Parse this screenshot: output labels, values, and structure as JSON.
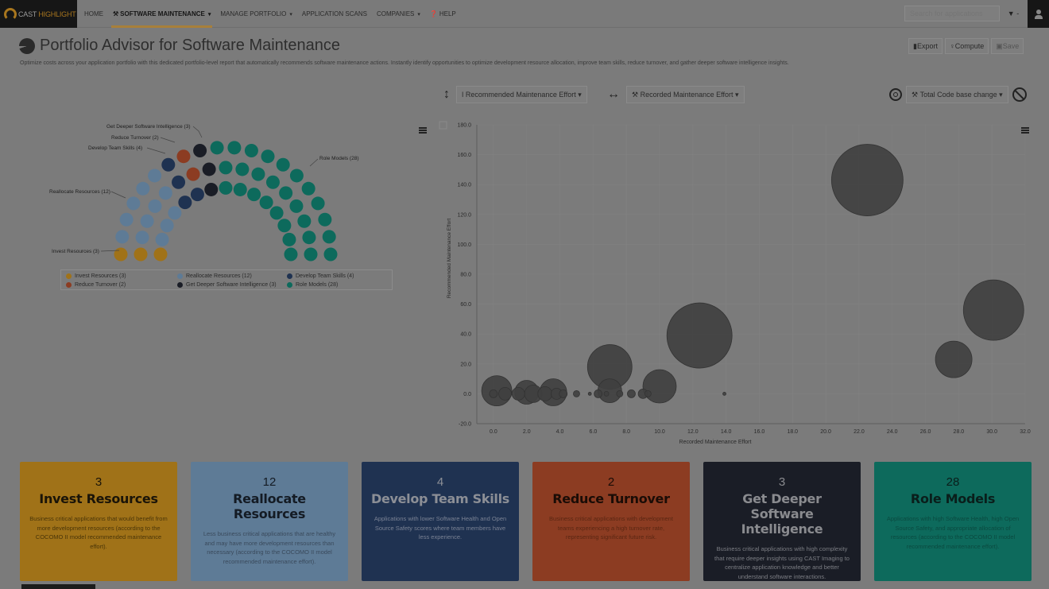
{
  "nav": {
    "brand": {
      "part1": "CAST ",
      "part2": "HIGHLIGHT"
    },
    "items": [
      {
        "label": "HOME",
        "active": false,
        "caret": false,
        "icon": ""
      },
      {
        "label": "SOFTWARE MAINTENANCE",
        "active": true,
        "caret": true,
        "icon": "wrench-icon"
      },
      {
        "label": "MANAGE PORTFOLIO",
        "active": false,
        "caret": true,
        "icon": ""
      },
      {
        "label": "APPLICATION SCANS",
        "active": false,
        "caret": false,
        "icon": ""
      },
      {
        "label": "COMPANIES",
        "active": false,
        "caret": true,
        "icon": ""
      },
      {
        "label": "HELP",
        "active": false,
        "caret": false,
        "icon": "question-circle-icon"
      }
    ],
    "search_placeholder": "Search for applications",
    "filter_label": "▼ -"
  },
  "page": {
    "title": "Portfolio Advisor for Software Maintenance",
    "subtitle": "Optimize costs across your application portfolio with this dedicated portfolio-level report that automatically recommends software maintenance actions. Instantly identify opportunities to optimize development resource allocation, improve team skills, reduce turnover, and gather deeper software intelligence insights.",
    "actions": {
      "export": "Export",
      "compute": "Compute",
      "save": "Save"
    }
  },
  "controls": {
    "y_axis": "Recommended Maintenance Effort",
    "x_axis": "Recorded Maintenance Effort",
    "size": "Total Code base change"
  },
  "colors": {
    "invest": "#a07218",
    "reallocate": "#5e7b96",
    "develop": "#1f3251",
    "turnover": "#8c3c22",
    "deeper": "#1a1d26",
    "role": "#0d6a5c"
  },
  "donut": {
    "labels": [
      {
        "text": "Get Deeper Software Intelligence (3)"
      },
      {
        "text": "Reduce Turnover (2)"
      },
      {
        "text": "Develop Team Skills (4)"
      },
      {
        "text": "Reallocate Resources (12)"
      },
      {
        "text": "Invest Resources (3)"
      },
      {
        "text": "Role Models (28)"
      }
    ],
    "legend": [
      {
        "label": "Invest Resources (3)",
        "key": "invest"
      },
      {
        "label": "Reallocate Resources (12)",
        "key": "reallocate"
      },
      {
        "label": "Develop Team Skills (4)",
        "key": "develop"
      },
      {
        "label": "Reduce Turnover (2)",
        "key": "turnover"
      },
      {
        "label": "Get Deeper Software Intelligence (3)",
        "key": "deeper"
      },
      {
        "label": "Role Models (28)",
        "key": "role"
      }
    ]
  },
  "chart_data": [
    {
      "type": "pie",
      "title": "",
      "categories": [
        "Invest Resources",
        "Reallocate Resources",
        "Develop Team Skills",
        "Reduce Turnover",
        "Get Deeper Software Intelligence",
        "Role Models"
      ],
      "values": [
        3,
        12,
        4,
        2,
        3,
        28
      ]
    },
    {
      "type": "scatter",
      "title": "",
      "xlabel": "Recorded Maintenance Effort",
      "ylabel": "Recommended Maintenance Effort",
      "xlim": [
        -1,
        32
      ],
      "ylim": [
        -20,
        180
      ],
      "xticks": [
        "0.0",
        "2.0",
        "4.0",
        "6.0",
        "8.0",
        "10.0",
        "12.0",
        "14.0",
        "16.0",
        "18.0",
        "20.0",
        "22.0",
        "24.0",
        "26.0",
        "28.0",
        "30.0",
        "32.0"
      ],
      "yticks": [
        "-20.0",
        "0.0",
        "20.0",
        "40.0",
        "60.0",
        "80.0",
        "100.0",
        "120.0",
        "140.0",
        "160.0",
        "180.0"
      ],
      "grid": true,
      "points": [
        {
          "x": 22.5,
          "y": 143,
          "size": 45
        },
        {
          "x": 30.1,
          "y": 56,
          "size": 38
        },
        {
          "x": 27.7,
          "y": 23,
          "size": 23
        },
        {
          "x": 12.4,
          "y": 39,
          "size": 41
        },
        {
          "x": 7.0,
          "y": 18,
          "size": 28
        },
        {
          "x": 10.0,
          "y": 5,
          "size": 21
        },
        {
          "x": 0.2,
          "y": 2,
          "size": 19
        },
        {
          "x": 2.0,
          "y": 1,
          "size": 15
        },
        {
          "x": 3.6,
          "y": 1,
          "size": 17
        },
        {
          "x": 7.0,
          "y": 2,
          "size": 15
        },
        {
          "x": 0.0,
          "y": 0,
          "size": 5
        },
        {
          "x": 0.7,
          "y": 0,
          "size": 8
        },
        {
          "x": 1.5,
          "y": 0,
          "size": 8
        },
        {
          "x": 2.4,
          "y": 0,
          "size": 11
        },
        {
          "x": 3.1,
          "y": 0,
          "size": 9
        },
        {
          "x": 3.8,
          "y": 0,
          "size": 7
        },
        {
          "x": 4.2,
          "y": 0,
          "size": 5
        },
        {
          "x": 5.0,
          "y": 0,
          "size": 4
        },
        {
          "x": 5.8,
          "y": 0,
          "size": 2
        },
        {
          "x": 6.3,
          "y": 0,
          "size": 5
        },
        {
          "x": 6.8,
          "y": 0,
          "size": 3
        },
        {
          "x": 7.6,
          "y": 0,
          "size": 4
        },
        {
          "x": 8.3,
          "y": 0,
          "size": 5
        },
        {
          "x": 9.0,
          "y": 0,
          "size": 6
        },
        {
          "x": 9.3,
          "y": 0,
          "size": 4
        },
        {
          "x": 13.9,
          "y": 0,
          "size": 2
        }
      ]
    }
  ],
  "cards": [
    {
      "count": "3",
      "title": "Invest Resources",
      "desc": "Business critical applications that would benefit from more development resources (according to the COCOMO II model recommended maintenance effort).",
      "key": "invest",
      "text": "#1a1408",
      "descColor": "#4a3508"
    },
    {
      "count": "12",
      "title": "Reallocate Resources",
      "desc": "Less business critical applications that are healthy and may have more development resources than necessary (according to the COCOMO II model recommended maintenance effort).",
      "key": "reallocate",
      "text": "#141b24",
      "descColor": "#3a4a5c"
    },
    {
      "count": "4",
      "title": "Develop Team Skills",
      "desc": "Applications with lower Software Health and Open Source Safety scores where team members have less experience.",
      "key": "develop",
      "text": "#8c8f96",
      "descColor": "#7a8294"
    },
    {
      "count": "2",
      "title": "Reduce Turnover",
      "desc": "Business critical applications with development teams experiencing a high turnover rate, representing significant future risk.",
      "key": "turnover",
      "text": "#1a0c06",
      "descColor": "#5a2612"
    },
    {
      "count": "3",
      "title": "Get Deeper Software Intelligence",
      "desc": "Business critical applications with high complexity that require deeper insights using CAST Imaging to centralize application knowledge and better understand software interactions.",
      "key": "deeper",
      "text": "#8a8b8f",
      "descColor": "#7c7e84"
    },
    {
      "count": "28",
      "title": "Role Models",
      "desc": "Applications with high Software Health, high Open Source Safety, and appropriate allocation of resources (according to the COCOMO II model recommended maintenance effort).",
      "key": "role",
      "text": "#0a1e1b",
      "descColor": "#0a4a40"
    }
  ]
}
